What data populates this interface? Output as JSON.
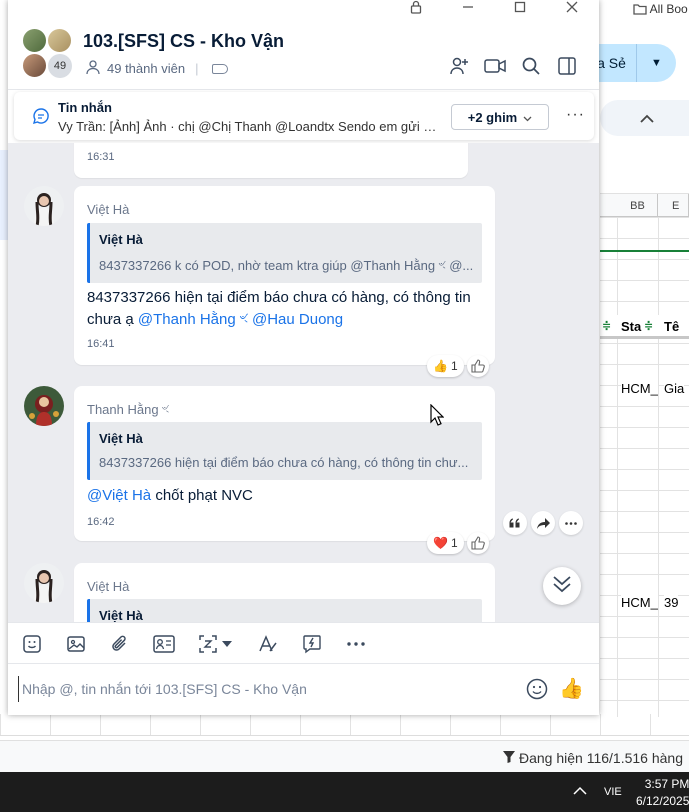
{
  "background": {
    "bookmark_label": "All Boo",
    "share_label": "ia Sẻ",
    "col_bb": "BB",
    "col_e": "E",
    "filter_col1": "Sta",
    "filter_col2": "Tê",
    "cell_r1c1": "HCM_",
    "cell_r1c2": "Gia",
    "cell_r2c1": "HCM_",
    "cell_r2c2": "39",
    "status_text": "Đang hiện 116/1.516 hàng"
  },
  "taskbar": {
    "lang": "VIE",
    "time": "3:57 PM",
    "date": "6/12/2025"
  },
  "chat": {
    "title": "103.[SFS] CS - Kho Vận",
    "member_count_badge": "49",
    "members_label": "49 thành viên",
    "pinned": {
      "title": "Tin nhắn",
      "preview": "Vy Trần: [Ảnh] Ảnh · chị @Chị Thanh @Loandtx Sendo em gửi đầu...",
      "pins_button": "+2 ghim",
      "more": "···"
    },
    "messages": [
      {
        "time": "16:31"
      },
      {
        "sender": "Việt Hà",
        "quote_name": "Việt Hà",
        "quote_text": "8437337266 k có POD, nhờ team ktra giúp @Thanh Hằng ৼ @...",
        "text_line1": "8437337266 hiện tại điểm báo chưa có hàng, có thông tin",
        "text_line2_prefix": "chưa ạ ",
        "mention1": "@Thanh Hằng ৼ",
        "mention2": "@Hau Duong",
        "time": "16:41",
        "reaction_count": "1"
      },
      {
        "sender": "Thanh Hằng ৼ",
        "quote_name": "Việt Hà",
        "quote_text": "8437337266 hiện tại điểm báo chưa có hàng, có thông tin chư...",
        "mention": "@Việt Hà",
        "text": " chốt phạt NVC",
        "time": "16:42",
        "reaction_count": "1"
      },
      {
        "sender": "Việt Hà",
        "quote_name": "Việt Hà"
      }
    ],
    "composer_placeholder": "Nhập @, tin nhắn tới 103.[SFS] CS - Kho Vận"
  }
}
